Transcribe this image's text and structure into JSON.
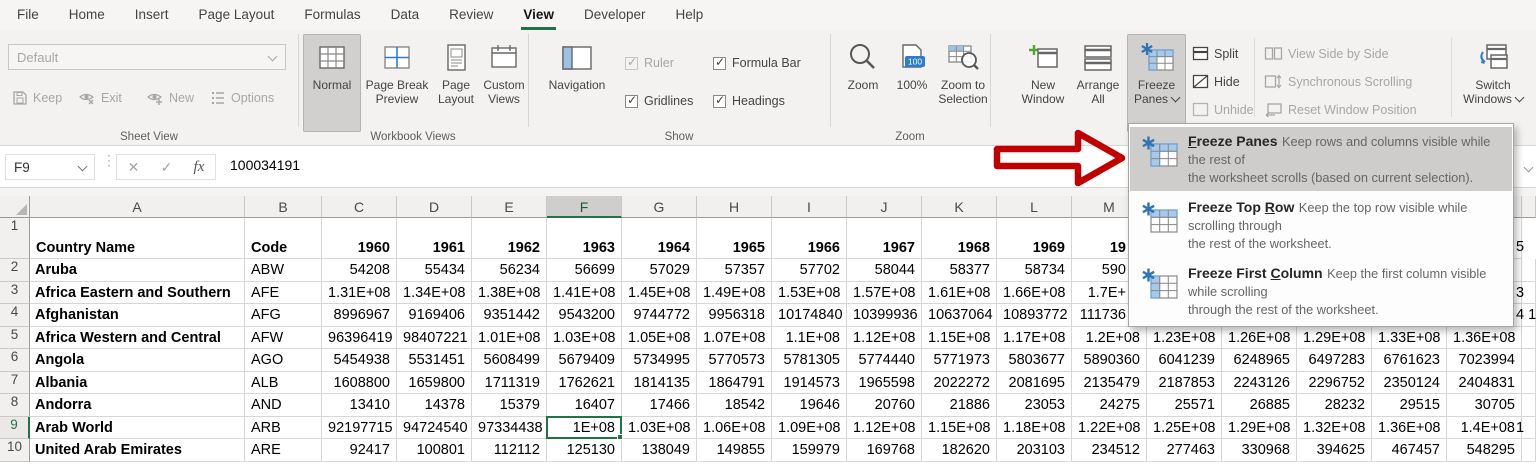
{
  "colors": {
    "excel_green": "#217346",
    "arrow_red": "#c00000",
    "icon_blue": "#2b7cd3",
    "freeze_cell_blue": "#a7c9ea"
  },
  "tabs": [
    {
      "label": "File"
    },
    {
      "label": "Home"
    },
    {
      "label": "Insert"
    },
    {
      "label": "Page Layout"
    },
    {
      "label": "Formulas"
    },
    {
      "label": "Data"
    },
    {
      "label": "Review"
    },
    {
      "label": "View",
      "active": true
    },
    {
      "label": "Developer"
    },
    {
      "label": "Help"
    }
  ],
  "ribbon": {
    "sheet_view": {
      "group_label": "Sheet View",
      "combo_value": "Default",
      "keep": "Keep",
      "exit": "Exit",
      "new": "New",
      "options": "Options"
    },
    "workbook_views": {
      "group_label": "Workbook Views",
      "normal": "Normal",
      "page_break_1": "Page Break",
      "page_break_2": "Preview",
      "page_layout_1": "Page",
      "page_layout_2": "Layout",
      "custom_views_1": "Custom",
      "custom_views_2": "Views"
    },
    "show": {
      "group_label": "Show",
      "navigation": "Navigation",
      "ruler": "Ruler",
      "gridlines": "Gridlines",
      "formula_bar": "Formula Bar",
      "headings": "Headings"
    },
    "zoom": {
      "group_label": "Zoom",
      "zoom": "Zoom",
      "pct": "100%",
      "zoom_sel_1": "Zoom to",
      "zoom_sel_2": "Selection"
    },
    "window": {
      "new_window_1": "New",
      "new_window_2": "Window",
      "arrange_1": "Arrange",
      "arrange_2": "All",
      "freeze_1": "Freeze",
      "freeze_2": "Panes",
      "split": "Split",
      "hide": "Hide",
      "unhide": "Unhide",
      "side_by_side": "View Side by Side",
      "sync_scroll": "Synchronous Scrolling",
      "reset_pos": "Reset Window Position",
      "switch_1": "Switch",
      "switch_2": "Windows"
    }
  },
  "formula_bar": {
    "name_box": "F9",
    "value": "100034191"
  },
  "freeze_menu": {
    "items": [
      {
        "pre": "",
        "key": "F",
        "rest": "reeze Panes",
        "desc1": "Keep rows and columns visible while the rest of",
        "desc2": "the worksheet scrolls (based on current selection).",
        "highlighted": true,
        "icon": "freeze-panes-icon"
      },
      {
        "pre": "Freeze Top ",
        "key": "R",
        "rest": "ow",
        "desc1": "Keep the top row visible while scrolling through",
        "desc2": "the rest of the worksheet.",
        "highlighted": false,
        "icon": "freeze-top-row-icon"
      },
      {
        "pre": "Freeze First ",
        "key": "C",
        "rest": "olumn",
        "desc1": "Keep the first column visible while scrolling",
        "desc2": "through the rest of the worksheet.",
        "highlighted": false,
        "icon": "freeze-first-column-icon"
      }
    ]
  },
  "grid": {
    "selection": {
      "cell": "F9",
      "col_letter": "F",
      "row_number": 9
    },
    "col_letters": [
      "A",
      "B",
      "C",
      "D",
      "E",
      "F",
      "G",
      "H",
      "I",
      "J",
      "K",
      "L",
      "M",
      "",
      "",
      "",
      "",
      "",
      ""
    ],
    "header_row": {
      "row_number": "1",
      "name": "Country Name",
      "code": "Code",
      "years": [
        "1960",
        "1961",
        "1962",
        "1963",
        "1964",
        "1965",
        "1966",
        "1967",
        "1968",
        "1969",
        "19",
        "",
        "",
        "",
        "",
        ""
      ]
    },
    "rows": [
      {
        "n": "2",
        "name": "Aruba",
        "code": "ABW",
        "partial_m": true,
        "values": [
          "54208",
          "55434",
          "56234",
          "56699",
          "57029",
          "57357",
          "57702",
          "58044",
          "58377",
          "58734",
          "590",
          "",
          "",
          "",
          "",
          ""
        ]
      },
      {
        "n": "3",
        "name": "Africa Eastern and Southern",
        "code": "AFE",
        "partial_m": true,
        "values": [
          "1.31E+08",
          "1.34E+08",
          "1.38E+08",
          "1.41E+08",
          "1.45E+08",
          "1.49E+08",
          "1.53E+08",
          "1.57E+08",
          "1.61E+08",
          "1.66E+08",
          "1.7E+",
          "",
          "",
          "",
          "",
          ""
        ]
      },
      {
        "n": "4",
        "name": "Afghanistan",
        "code": "AFG",
        "partial_m": true,
        "values": [
          "8996967",
          "9169406",
          "9351442",
          "9543200",
          "9744772",
          "9956318",
          "10174840",
          "10399936",
          "10637064",
          "10893772",
          "111736",
          "",
          "",
          "",
          "",
          ""
        ]
      },
      {
        "n": "5",
        "name": "Africa Western and Central",
        "code": "AFW",
        "values": [
          "96396419",
          "98407221",
          "1.01E+08",
          "1.03E+08",
          "1.05E+08",
          "1.07E+08",
          "1.1E+08",
          "1.12E+08",
          "1.15E+08",
          "1.17E+08",
          "1.2E+08",
          "1.23E+08",
          "1.26E+08",
          "1.29E+08",
          "1.33E+08",
          "1.36E+08"
        ]
      },
      {
        "n": "6",
        "name": "Angola",
        "code": "AGO",
        "values": [
          "5454938",
          "5531451",
          "5608499",
          "5679409",
          "5734995",
          "5770573",
          "5781305",
          "5774440",
          "5771973",
          "5803677",
          "5890360",
          "6041239",
          "6248965",
          "6497283",
          "6761623",
          "7023994"
        ]
      },
      {
        "n": "7",
        "name": "Albania",
        "code": "ALB",
        "values": [
          "1608800",
          "1659800",
          "1711319",
          "1762621",
          "1814135",
          "1864791",
          "1914573",
          "1965598",
          "2022272",
          "2081695",
          "2135479",
          "2187853",
          "2243126",
          "2296752",
          "2350124",
          "2404831"
        ]
      },
      {
        "n": "8",
        "name": "Andorra",
        "code": "AND",
        "values": [
          "13410",
          "14378",
          "15379",
          "16407",
          "17466",
          "18542",
          "19646",
          "20760",
          "21886",
          "23053",
          "24275",
          "25571",
          "26885",
          "28232",
          "29515",
          "30705"
        ]
      },
      {
        "n": "9",
        "name": "Arab World",
        "code": "ARB",
        "selected": true,
        "values": [
          "92197715",
          "94724540",
          "97334438",
          "1E+08",
          "1.03E+08",
          "1.06E+08",
          "1.09E+08",
          "1.12E+08",
          "1.15E+08",
          "1.18E+08",
          "1.22E+08",
          "1.25E+08",
          "1.29E+08",
          "1.32E+08",
          "1.36E+08",
          "1.4E+08"
        ]
      },
      {
        "n": "10",
        "name": "United Arab Emirates",
        "code": "ARE",
        "values": [
          "92417",
          "100801",
          "112112",
          "125130",
          "138049",
          "149855",
          "159979",
          "169768",
          "182620",
          "203103",
          "234512",
          "277463",
          "330968",
          "394625",
          "467457",
          "548295"
        ]
      }
    ],
    "edge_slivers": [
      {
        "row": "1",
        "text": "5"
      },
      {
        "row": "3",
        "text": "3"
      },
      {
        "row": "4",
        "text": "4 1"
      },
      {
        "row": "9",
        "text": "1"
      }
    ]
  }
}
